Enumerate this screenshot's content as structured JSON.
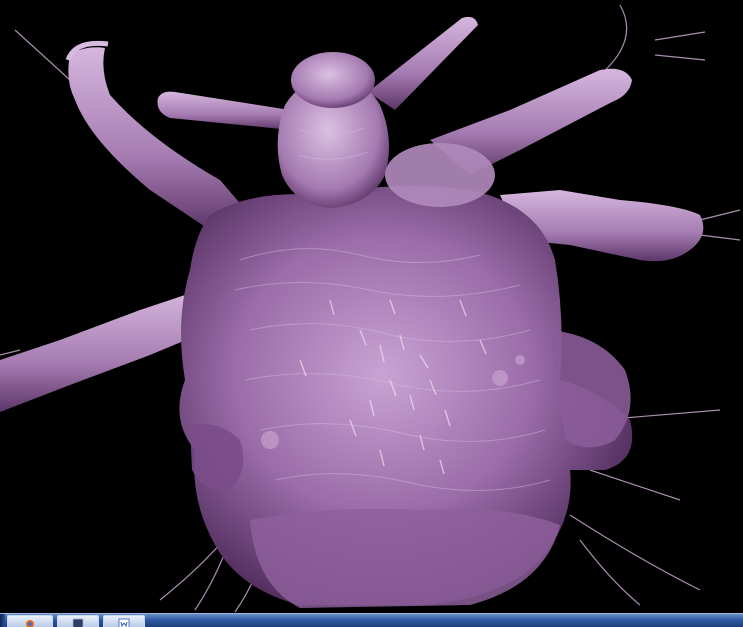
{
  "image": {
    "alt": "",
    "background_color": "#000000",
    "subject_color": "#a47ab0",
    "highlight_color": "#d9b8e2",
    "shadow_color": "#3c1e45"
  },
  "taskbar": {
    "color": "#2f5aa3",
    "buttons": [
      {
        "icon": "browser-icon"
      },
      {
        "icon": "window-icon"
      },
      {
        "icon": "word-document-icon"
      }
    ]
  }
}
